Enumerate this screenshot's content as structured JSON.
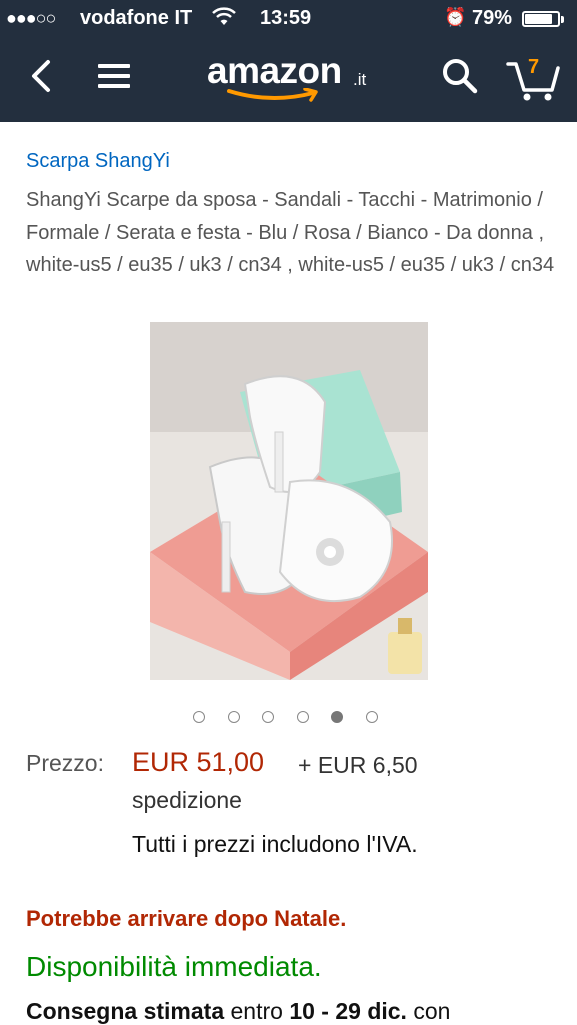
{
  "status_bar": {
    "signal": "●●●○○",
    "carrier": "vodafone IT",
    "time": "13:59",
    "battery": "79%",
    "battery_level": 0.79
  },
  "header": {
    "logo_text": "amazon",
    "logo_tld": ".it",
    "cart_count": "7",
    "background_color": "#232f3e",
    "accent_color": "#ff9900",
    "icons": [
      "back-icon",
      "menu-icon",
      "search-icon",
      "cart-icon"
    ]
  },
  "product": {
    "brand_link": "Scarpa ShangYi",
    "title": "ShangYi Scarpe da sposa - Sandali - Tacchi - Matrimonio / Formale / Serata e festa - Blu / Rosa / Bianco - Da donna , white-us5 / eu35 / uk3 / cn34 , white-us5 / eu35 / uk3 / cn34",
    "image_count": 6,
    "active_image_index": 4
  },
  "pricing": {
    "label": "Prezzo:",
    "price": "EUR 51,00",
    "shipping_line1": "+ EUR 6,50",
    "shipping_line2": "spedizione",
    "vat_note": "Tutti i prezzi includono l'IVA.",
    "price_color": "#b12704"
  },
  "availability": {
    "warning": "Potrebbe arrivare dopo Natale.",
    "status": "Disponibilità immediata.",
    "status_color": "#008a00",
    "delivery_prefix": "Consegna stimata",
    "delivery_mid": "entro",
    "delivery_dates": "10 - 29 dic.",
    "delivery_suffix": "con"
  }
}
